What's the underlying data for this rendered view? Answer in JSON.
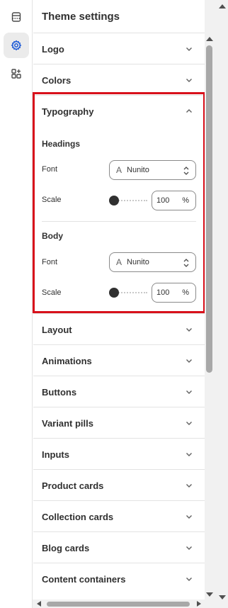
{
  "panel": {
    "title": "Theme settings"
  },
  "sections": {
    "logo": "Logo",
    "colors": "Colors",
    "typography": "Typography",
    "layout": "Layout",
    "animations": "Animations",
    "buttons": "Buttons",
    "variant_pills": "Variant pills",
    "inputs": "Inputs",
    "product_cards": "Product cards",
    "collection_cards": "Collection cards",
    "blog_cards": "Blog cards",
    "content_containers": "Content containers"
  },
  "typography": {
    "headings": {
      "label": "Headings",
      "font_label": "Font",
      "font_value": "Nunito",
      "scale_label": "Scale",
      "scale_value": "100",
      "scale_unit": "%",
      "slider_level": 0.0
    },
    "body": {
      "label": "Body",
      "font_label": "Font",
      "font_value": "Nunito",
      "scale_label": "Scale",
      "scale_value": "100",
      "scale_unit": "%",
      "slider_level": 0.0
    }
  },
  "icons": {
    "font_icon_glyph": "A",
    "rail": [
      "sections-icon",
      "settings-gear-icon",
      "apps-add-icon"
    ]
  },
  "colors": {
    "highlight": "#d8111b",
    "text": "#303030",
    "border": "#e3e3e3"
  }
}
